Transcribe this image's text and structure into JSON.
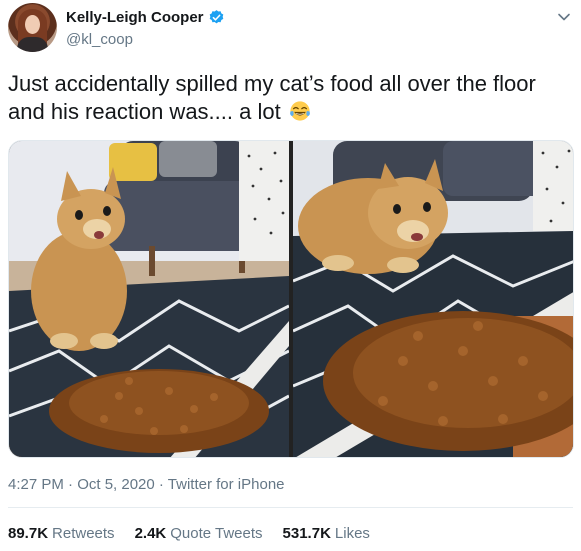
{
  "author": {
    "display_name": "Kelly-Leigh Cooper",
    "handle": "@kl_coop",
    "verified": true
  },
  "tweet": {
    "text": "Just accidentally spilled my cat’s food all over the floor and his reaction was.... a lot",
    "emoji": "face-with-tears-of-joy",
    "timestamp": "4:27 PM · Oct 5, 2020 · Twitter for iPhone"
  },
  "stats": {
    "retweets_count": "89.7K",
    "retweets_label": "Retweets",
    "quotes_count": "2.4K",
    "quotes_label": "Quote Tweets",
    "likes_count": "531.7K",
    "likes_label": "Likes"
  },
  "colors": {
    "text": "#14171a",
    "secondary": "#657786",
    "verified_blue": "#1da1f2",
    "divider": "#e6ecf0"
  }
}
